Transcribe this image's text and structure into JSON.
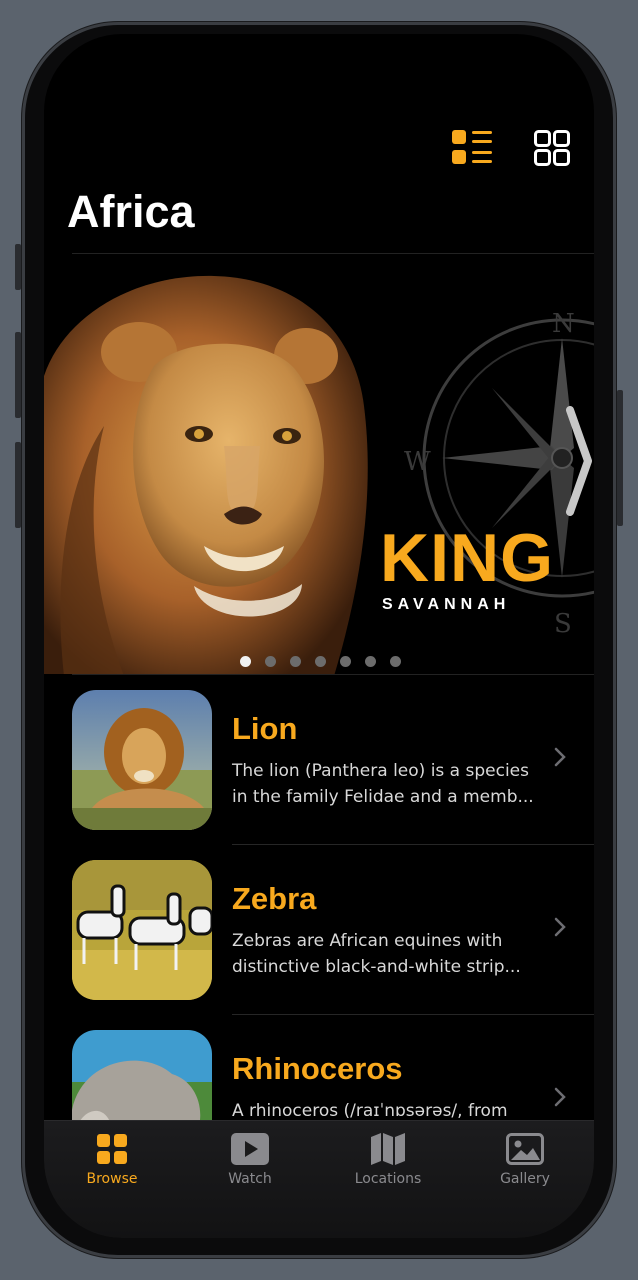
{
  "colors": {
    "accent": "#f8a91e",
    "background": "#000000",
    "inactive": "#8a8a8e"
  },
  "header": {
    "title": "Africa",
    "view_toggles": [
      {
        "icon": "list-view-icon",
        "active": true
      },
      {
        "icon": "grid-view-icon",
        "active": false
      }
    ]
  },
  "hero": {
    "headline": "KING",
    "subheadline": "SAVANNAH",
    "compass_letters": {
      "n": "N",
      "w": "W",
      "s": "S"
    },
    "page_count": 7,
    "active_page": 1,
    "next_icon": "chevron-right-icon"
  },
  "animals": [
    {
      "name": "Lion",
      "description": "The lion (Panthera leo) is a species\nin the family Felidae and a memb..."
    },
    {
      "name": "Zebra",
      "description": "Zebras are African equines with\ndistinctive black-and-white strip..."
    },
    {
      "name": "Rhinoceros",
      "description": "A rhinoceros (/raɪˈnɒsərəs/, from"
    }
  ],
  "tabbar": {
    "tabs": [
      {
        "label": "Browse",
        "icon": "browse-grid-icon",
        "active": true
      },
      {
        "label": "Watch",
        "icon": "play-icon",
        "active": false
      },
      {
        "label": "Locations",
        "icon": "map-icon",
        "active": false
      },
      {
        "label": "Gallery",
        "icon": "photo-icon",
        "active": false
      }
    ]
  }
}
